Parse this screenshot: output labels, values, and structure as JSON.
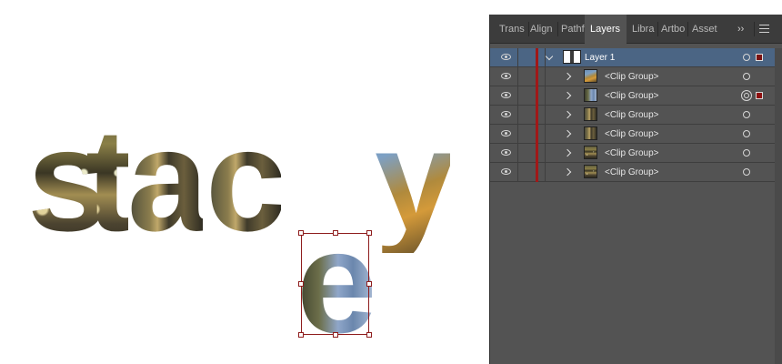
{
  "canvas": {
    "letters": [
      {
        "char": "s"
      },
      {
        "char": "t"
      },
      {
        "char": "a"
      },
      {
        "char": "c"
      },
      {
        "char": "y"
      },
      {
        "char": "e",
        "selected": true
      }
    ]
  },
  "layers_panel": {
    "tabs": [
      {
        "label": "Trans",
        "active": false
      },
      {
        "label": "Align",
        "active": false
      },
      {
        "label": "Pathf",
        "active": false
      },
      {
        "label": "Layers",
        "active": true
      },
      {
        "label": "Libra",
        "active": false
      },
      {
        "label": "Artbo",
        "active": false
      },
      {
        "label": "Asset",
        "active": false
      }
    ],
    "overflow_label": "››",
    "layer_color": "#a01818",
    "selected_row_color": "#4b6584",
    "rows": [
      {
        "label": "Layer 1",
        "type": "layer",
        "expanded": true,
        "visible": true,
        "selected": true
      },
      {
        "label": "<Clip Group>",
        "type": "clip-group",
        "expanded": false,
        "visible": true,
        "targeted": false
      },
      {
        "label": "<Clip Group>",
        "type": "clip-group",
        "expanded": false,
        "visible": true,
        "targeted": true
      },
      {
        "label": "<Clip Group>",
        "type": "clip-group",
        "expanded": false,
        "visible": true,
        "targeted": false
      },
      {
        "label": "<Clip Group>",
        "type": "clip-group",
        "expanded": false,
        "visible": true,
        "targeted": false
      },
      {
        "label": "<Clip Group>",
        "type": "clip-group",
        "expanded": false,
        "visible": true,
        "targeted": false
      },
      {
        "label": "<Clip Group>",
        "type": "clip-group",
        "expanded": false,
        "visible": true,
        "targeted": false
      }
    ]
  }
}
